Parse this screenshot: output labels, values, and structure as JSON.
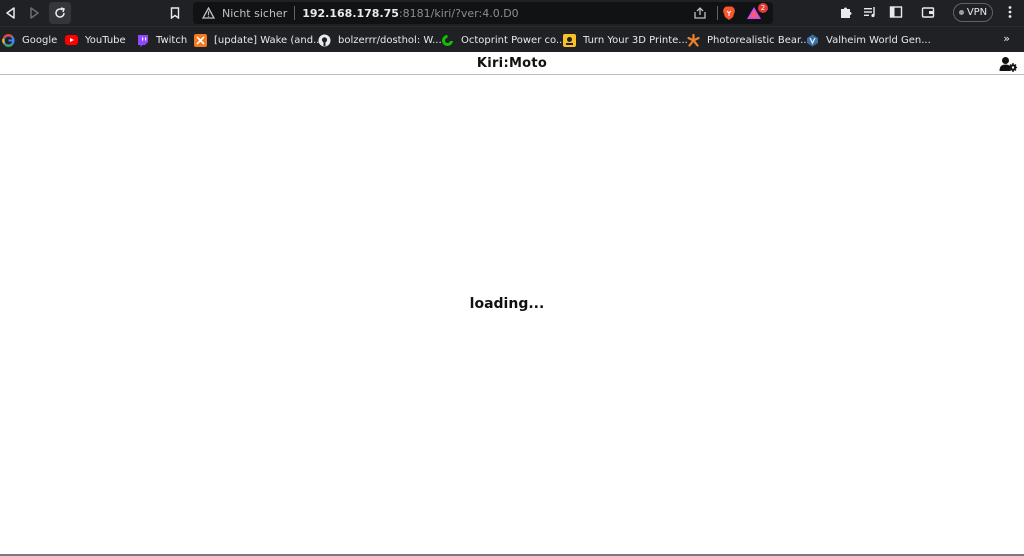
{
  "browser": {
    "security_label": "Nicht sicher",
    "url_host": "192.168.178.75",
    "url_path": ":8181/kiri/?ver:4.0.D0",
    "rewards_count": "2",
    "vpn_label": "VPN"
  },
  "bookmarks": [
    {
      "label": "Google",
      "icon": "google-icon"
    },
    {
      "label": "YouTube",
      "icon": "youtube-icon"
    },
    {
      "label": "Twitch",
      "icon": "twitch-icon"
    },
    {
      "label": "[update] Wake (and...",
      "icon": "wake-icon"
    },
    {
      "label": "bolzerrr/dosthol: W...",
      "icon": "github-icon"
    },
    {
      "label": "Octoprint Power co...",
      "icon": "octoprint-icon"
    },
    {
      "label": "Turn Your 3D Printe...",
      "icon": "instructables-icon"
    },
    {
      "label": "Photorealistic Bear...",
      "icon": "photorealistic-icon"
    },
    {
      "label": "Valheim World Gen...",
      "icon": "valheim-icon"
    }
  ],
  "bookmarks_more": "»",
  "app": {
    "title": "Kiri:Moto",
    "loading_text": "loading..."
  },
  "colors": {
    "chrome_bg": "#202124",
    "brave_orange": "#fb542b",
    "page_bg": "#ffffff"
  }
}
